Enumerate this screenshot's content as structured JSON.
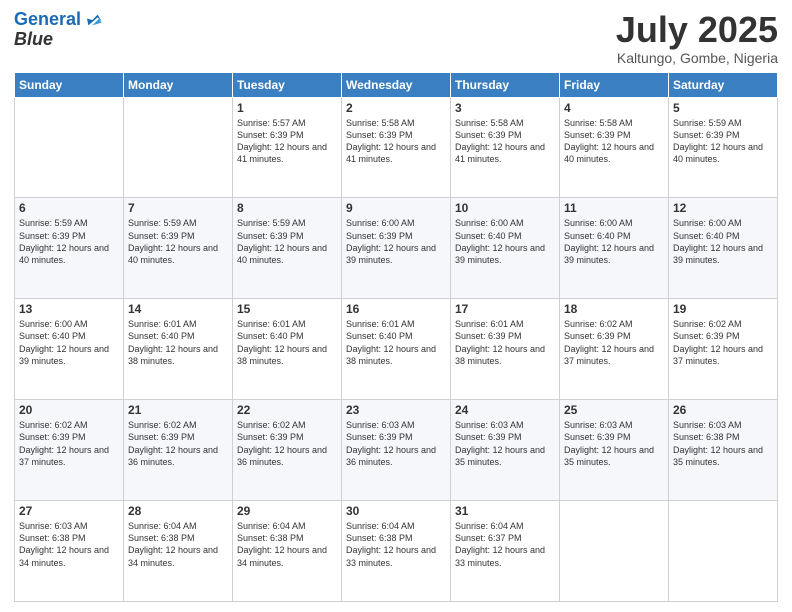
{
  "logo": {
    "line1": "General",
    "line2": "Blue"
  },
  "header": {
    "month": "July 2025",
    "location": "Kaltungo, Gombe, Nigeria"
  },
  "weekdays": [
    "Sunday",
    "Monday",
    "Tuesday",
    "Wednesday",
    "Thursday",
    "Friday",
    "Saturday"
  ],
  "weeks": [
    [
      {
        "day": "",
        "detail": ""
      },
      {
        "day": "",
        "detail": ""
      },
      {
        "day": "1",
        "detail": "Sunrise: 5:57 AM\nSunset: 6:39 PM\nDaylight: 12 hours\nand 41 minutes."
      },
      {
        "day": "2",
        "detail": "Sunrise: 5:58 AM\nSunset: 6:39 PM\nDaylight: 12 hours\nand 41 minutes."
      },
      {
        "day": "3",
        "detail": "Sunrise: 5:58 AM\nSunset: 6:39 PM\nDaylight: 12 hours\nand 41 minutes."
      },
      {
        "day": "4",
        "detail": "Sunrise: 5:58 AM\nSunset: 6:39 PM\nDaylight: 12 hours\nand 40 minutes."
      },
      {
        "day": "5",
        "detail": "Sunrise: 5:59 AM\nSunset: 6:39 PM\nDaylight: 12 hours\nand 40 minutes."
      }
    ],
    [
      {
        "day": "6",
        "detail": "Sunrise: 5:59 AM\nSunset: 6:39 PM\nDaylight: 12 hours\nand 40 minutes."
      },
      {
        "day": "7",
        "detail": "Sunrise: 5:59 AM\nSunset: 6:39 PM\nDaylight: 12 hours\nand 40 minutes."
      },
      {
        "day": "8",
        "detail": "Sunrise: 5:59 AM\nSunset: 6:39 PM\nDaylight: 12 hours\nand 40 minutes."
      },
      {
        "day": "9",
        "detail": "Sunrise: 6:00 AM\nSunset: 6:39 PM\nDaylight: 12 hours\nand 39 minutes."
      },
      {
        "day": "10",
        "detail": "Sunrise: 6:00 AM\nSunset: 6:40 PM\nDaylight: 12 hours\nand 39 minutes."
      },
      {
        "day": "11",
        "detail": "Sunrise: 6:00 AM\nSunset: 6:40 PM\nDaylight: 12 hours\nand 39 minutes."
      },
      {
        "day": "12",
        "detail": "Sunrise: 6:00 AM\nSunset: 6:40 PM\nDaylight: 12 hours\nand 39 minutes."
      }
    ],
    [
      {
        "day": "13",
        "detail": "Sunrise: 6:00 AM\nSunset: 6:40 PM\nDaylight: 12 hours\nand 39 minutes."
      },
      {
        "day": "14",
        "detail": "Sunrise: 6:01 AM\nSunset: 6:40 PM\nDaylight: 12 hours\nand 38 minutes."
      },
      {
        "day": "15",
        "detail": "Sunrise: 6:01 AM\nSunset: 6:40 PM\nDaylight: 12 hours\nand 38 minutes."
      },
      {
        "day": "16",
        "detail": "Sunrise: 6:01 AM\nSunset: 6:40 PM\nDaylight: 12 hours\nand 38 minutes."
      },
      {
        "day": "17",
        "detail": "Sunrise: 6:01 AM\nSunset: 6:39 PM\nDaylight: 12 hours\nand 38 minutes."
      },
      {
        "day": "18",
        "detail": "Sunrise: 6:02 AM\nSunset: 6:39 PM\nDaylight: 12 hours\nand 37 minutes."
      },
      {
        "day": "19",
        "detail": "Sunrise: 6:02 AM\nSunset: 6:39 PM\nDaylight: 12 hours\nand 37 minutes."
      }
    ],
    [
      {
        "day": "20",
        "detail": "Sunrise: 6:02 AM\nSunset: 6:39 PM\nDaylight: 12 hours\nand 37 minutes."
      },
      {
        "day": "21",
        "detail": "Sunrise: 6:02 AM\nSunset: 6:39 PM\nDaylight: 12 hours\nand 36 minutes."
      },
      {
        "day": "22",
        "detail": "Sunrise: 6:02 AM\nSunset: 6:39 PM\nDaylight: 12 hours\nand 36 minutes."
      },
      {
        "day": "23",
        "detail": "Sunrise: 6:03 AM\nSunset: 6:39 PM\nDaylight: 12 hours\nand 36 minutes."
      },
      {
        "day": "24",
        "detail": "Sunrise: 6:03 AM\nSunset: 6:39 PM\nDaylight: 12 hours\nand 35 minutes."
      },
      {
        "day": "25",
        "detail": "Sunrise: 6:03 AM\nSunset: 6:39 PM\nDaylight: 12 hours\nand 35 minutes."
      },
      {
        "day": "26",
        "detail": "Sunrise: 6:03 AM\nSunset: 6:38 PM\nDaylight: 12 hours\nand 35 minutes."
      }
    ],
    [
      {
        "day": "27",
        "detail": "Sunrise: 6:03 AM\nSunset: 6:38 PM\nDaylight: 12 hours\nand 34 minutes."
      },
      {
        "day": "28",
        "detail": "Sunrise: 6:04 AM\nSunset: 6:38 PM\nDaylight: 12 hours\nand 34 minutes."
      },
      {
        "day": "29",
        "detail": "Sunrise: 6:04 AM\nSunset: 6:38 PM\nDaylight: 12 hours\nand 34 minutes."
      },
      {
        "day": "30",
        "detail": "Sunrise: 6:04 AM\nSunset: 6:38 PM\nDaylight: 12 hours\nand 33 minutes."
      },
      {
        "day": "31",
        "detail": "Sunrise: 6:04 AM\nSunset: 6:37 PM\nDaylight: 12 hours\nand 33 minutes."
      },
      {
        "day": "",
        "detail": ""
      },
      {
        "day": "",
        "detail": ""
      }
    ]
  ]
}
